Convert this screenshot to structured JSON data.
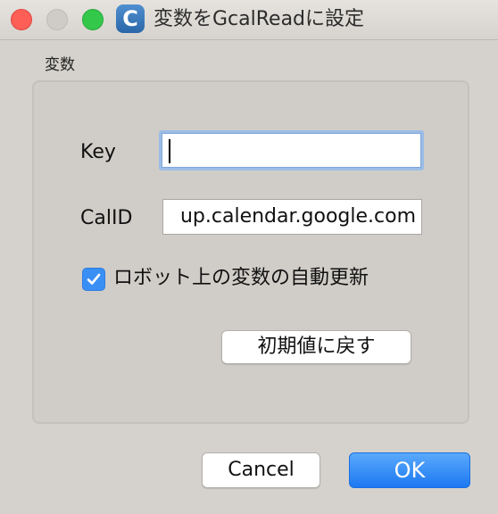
{
  "window": {
    "title": "変数をGcalReadに設定",
    "app_icon_letter": "C"
  },
  "group": {
    "label": "変数"
  },
  "fields": {
    "key_label": "Key",
    "key_value": "",
    "calid_label": "CalID",
    "calid_value": "up.calendar.google.com"
  },
  "checkbox": {
    "label": "ロボット上の変数の自動更新",
    "checked": true
  },
  "buttons": {
    "reset_label": "初期値に戻す",
    "cancel_label": "Cancel",
    "ok_label": "OK"
  },
  "colors": {
    "accent": "#3a8ff5",
    "close": "#fd5f57",
    "maximize": "#34c84a"
  }
}
